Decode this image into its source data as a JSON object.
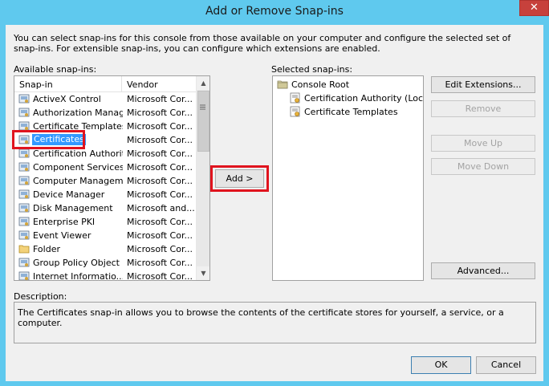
{
  "window": {
    "title": "Add or Remove Snap-ins",
    "close_glyph": "✕"
  },
  "intro_text": "You can select snap-ins for this console from those available on your computer and configure the selected set of snap-ins. For extensible snap-ins, you can configure which extensions are enabled.",
  "available": {
    "label": "Available snap-ins:",
    "col_snapin": "Snap-in",
    "col_vendor": "Vendor",
    "rows": [
      {
        "name": "ActiveX Control",
        "vendor": "Microsoft Cor...",
        "icon": "activex-icon"
      },
      {
        "name": "Authorization Manager",
        "vendor": "Microsoft Cor...",
        "icon": "authorization-icon"
      },
      {
        "name": "Certificate Templates",
        "vendor": "Microsoft Cor...",
        "icon": "certificate-templates-icon"
      },
      {
        "name": "Certificates",
        "vendor": "Microsoft Cor...",
        "icon": "certificates-icon",
        "selected": true
      },
      {
        "name": "Certification Authority",
        "vendor": "Microsoft Cor...",
        "icon": "certification-authority-icon"
      },
      {
        "name": "Component Services",
        "vendor": "Microsoft Cor...",
        "icon": "component-services-icon"
      },
      {
        "name": "Computer Managem...",
        "vendor": "Microsoft Cor...",
        "icon": "computer-management-icon"
      },
      {
        "name": "Device Manager",
        "vendor": "Microsoft Cor...",
        "icon": "device-manager-icon"
      },
      {
        "name": "Disk Management",
        "vendor": "Microsoft and...",
        "icon": "disk-management-icon"
      },
      {
        "name": "Enterprise PKI",
        "vendor": "Microsoft Cor...",
        "icon": "enterprise-pki-icon"
      },
      {
        "name": "Event Viewer",
        "vendor": "Microsoft Cor...",
        "icon": "event-viewer-icon"
      },
      {
        "name": "Folder",
        "vendor": "Microsoft Cor...",
        "icon": "folder-icon"
      },
      {
        "name": "Group Policy Object ...",
        "vendor": "Microsoft Cor...",
        "icon": "group-policy-icon"
      },
      {
        "name": "Internet Informatio...",
        "vendor": "Microsoft Cor...",
        "icon": "iis-icon"
      }
    ]
  },
  "add_button": "Add >",
  "selected": {
    "label": "Selected snap-ins:",
    "root": "Console Root",
    "children": [
      "Certification Authority (Local)",
      "Certificate Templates"
    ]
  },
  "side_buttons": {
    "edit_extensions": "Edit Extensions...",
    "remove": "Remove",
    "move_up": "Move Up",
    "move_down": "Move Down",
    "advanced": "Advanced..."
  },
  "description": {
    "label": "Description:",
    "text": "The Certificates snap-in allows you to browse the contents of the certificate stores for yourself, a service, or a computer."
  },
  "footer": {
    "ok": "OK",
    "cancel": "Cancel"
  },
  "colors": {
    "titlebar": "#5fc9ee",
    "selection": "#3399ff",
    "highlight_border": "#e0141e",
    "close_button": "#c7413c"
  }
}
